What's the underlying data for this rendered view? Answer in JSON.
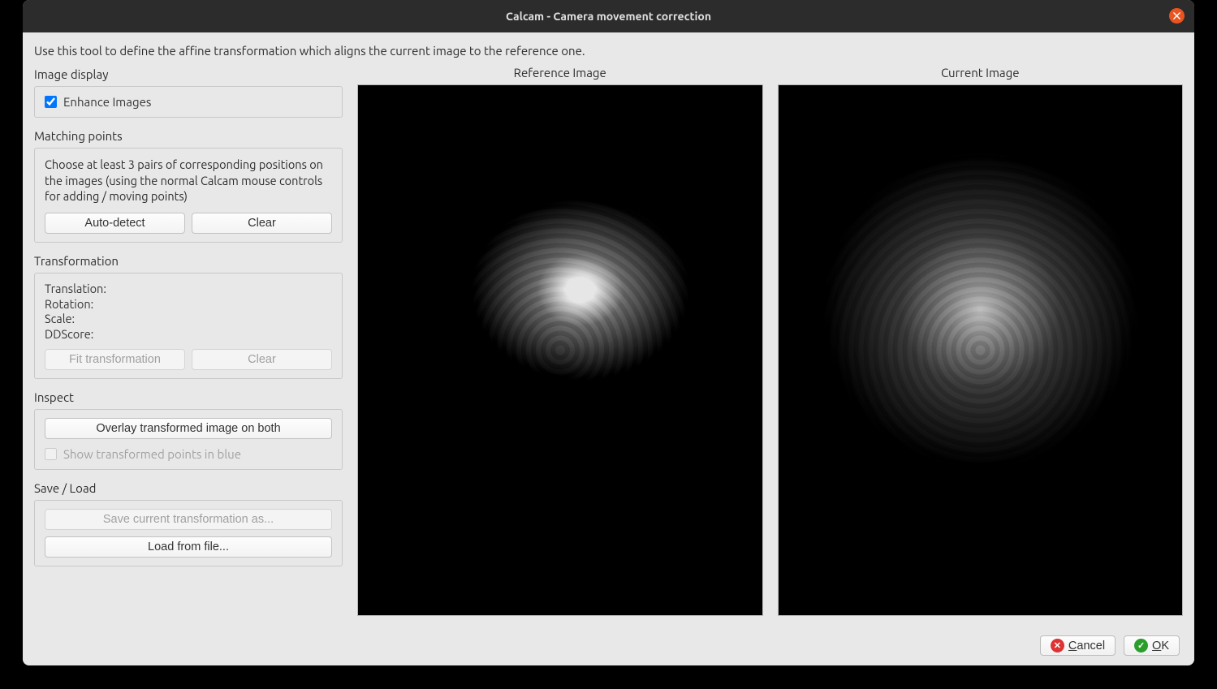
{
  "window": {
    "title": "Calcam - Camera movement correction"
  },
  "intro": "Use this tool to define the affine transformation which aligns the current image to the reference one.",
  "image_display": {
    "section_label": "Image display",
    "enhance_label": "Enhance Images",
    "enhance_checked": true
  },
  "matching_points": {
    "section_label": "Matching points",
    "hint": "Choose at least 3 pairs of corresponding positions on the images (using the normal Calcam mouse controls for adding / moving points)",
    "autodetect_label": "Auto-detect",
    "clear_label": "Clear"
  },
  "transformation": {
    "section_label": "Transformation",
    "translation_label": "Translation:",
    "rotation_label": "Rotation:",
    "scale_label": "Scale:",
    "ddscore_label": "DDScore:",
    "fit_label": "Fit transformation",
    "clear_label": "Clear"
  },
  "inspect": {
    "section_label": "Inspect",
    "overlay_label": "Overlay transformed image on both",
    "show_points_label": "Show transformed points in blue"
  },
  "save_load": {
    "section_label": "Save / Load",
    "save_label": "Save current transformation as...",
    "load_label": "Load from file..."
  },
  "images": {
    "reference_label": "Reference Image",
    "current_label": "Current Image"
  },
  "footer": {
    "cancel_label": "Cancel",
    "ok_label": "OK"
  }
}
